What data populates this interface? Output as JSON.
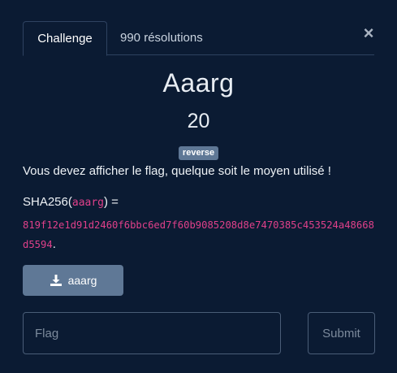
{
  "tabs": [
    {
      "label": "Challenge",
      "active": true
    },
    {
      "label": "990 résolutions",
      "active": false
    }
  ],
  "close_icon": "close-icon",
  "challenge": {
    "name": "Aaarg",
    "points": "20",
    "category": "reverse",
    "description": "Vous devez afficher le flag, quelque soit le moyen utilisé !",
    "sha_prefix": "SHA256(",
    "sha_file": "aaarg",
    "sha_suffix": ") =",
    "hash": "819f12e1d91d2460f6bbc6ed7f60b9085208d8e7470385c453524a48668d5594",
    "hash_end": "."
  },
  "download": {
    "label": "aaarg",
    "icon": "download-icon"
  },
  "flag_form": {
    "placeholder": "Flag",
    "value": "",
    "submit_label": "Submit"
  },
  "colors": {
    "background": "#0b1b33",
    "badge": "#5f7896",
    "button": "#5f7896",
    "code": "#e0408a",
    "border": "#4a5d77"
  }
}
